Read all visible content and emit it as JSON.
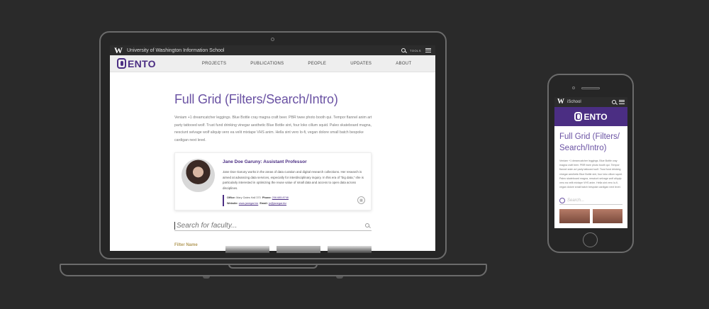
{
  "site": {
    "uw_logo": "W",
    "school_name": "University of Washington Information School",
    "tools_label": "TOOLS",
    "brand": "ENTO",
    "nav": [
      "PROJECTS",
      "PUBLICATIONS",
      "PEOPLE",
      "UPDATES",
      "ABOUT"
    ]
  },
  "page": {
    "title": "Full Grid (Filters/Search/Intro)",
    "intro": "Veniam +1 dreamcatcher leggings. Blue Bottle cray magna craft beer. PBR twee photo booth qui. Tempor flannel anim art party tattooed wolf. Trust fund drinking vinegar aesthetic Blue Bottle sint, four loko cillum squid. Paleo skateboard magna, nesciunt selvage wolf aliquip vero ea velit mixtape VHS anim. Hella sint vero lo-fi, vegan dolore small batch bespoke cardigan next level."
  },
  "profile": {
    "name": "Jane Doe Garuny: Assistant Professor",
    "bio": "Jane Doe Garuny works in the areas of data curation and digital research collections. Her research is aimed at advancing data services, especially for interdisciplinary inquiry. In this era of \"big data,\" she is particularly interested in optimizing the reuse value of small data and access to open data across disciplines.",
    "office_label": "Office:",
    "office": "Mary Gates Hall 370",
    "phone_label": "Phone:",
    "phone": "206.685.8746",
    "website_label": "Website:",
    "website": "www.janegar.biz",
    "email_label": "Email:",
    "email": "jo@janegar.biz"
  },
  "search": {
    "placeholder": "Search for faculty...",
    "filter_label": "Filter Name"
  },
  "mobile": {
    "uw_logo": "W",
    "school_short": "iSchool",
    "brand": "ENTO",
    "title": "Full Grid (Filters/ Search/Intro)",
    "intro": "Veniam +1 dreamcatcher leggings. Blue Bottle cray magna craft beer. PBR twee photo booth qui. Tempor flannel anim art party tattooed wolf. Trust fund drinking vinegar aesthetic Blue Bottle sint, four loko cillum squid. Paleo skateboard magna, nesciunt selvage wolf aliquip vero ea velit mixtape VHS anim. Hella sint vero lo-fi, vegan dolore small batch bespoke cardigan next level.",
    "search_placeholder": "Search..."
  },
  "colors": {
    "purple": "#4b2e83",
    "gold": "#b39b5b"
  }
}
